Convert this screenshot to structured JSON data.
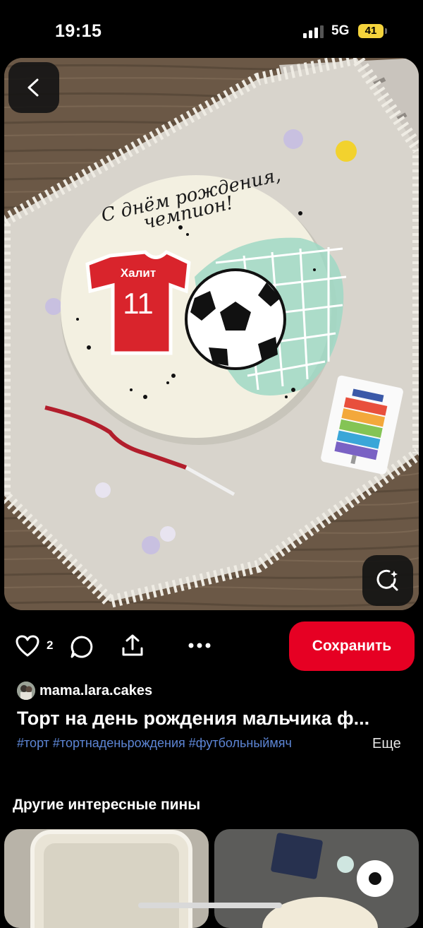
{
  "status_bar": {
    "time": "19:15",
    "network": "5G",
    "battery": "41"
  },
  "pin": {
    "image_description": "cake",
    "cake_text_line1": "С днём рождения,",
    "cake_text_line2": "чемпион!",
    "jersey_name": "Халит",
    "jersey_number": "11",
    "like_count": "2",
    "save_label": "Сохранить",
    "author": "mama.lara.cakes",
    "title": "Торт на день рождения мальчика ф...",
    "hashtags": "#торт #тортнаденьрождения #футбольныймяч",
    "more_label": "Еще"
  },
  "related": {
    "title": "Другие интересные пины"
  },
  "colors": {
    "save": "#e60023",
    "hashtag": "#5d86d6",
    "battery": "#f4d33c"
  }
}
